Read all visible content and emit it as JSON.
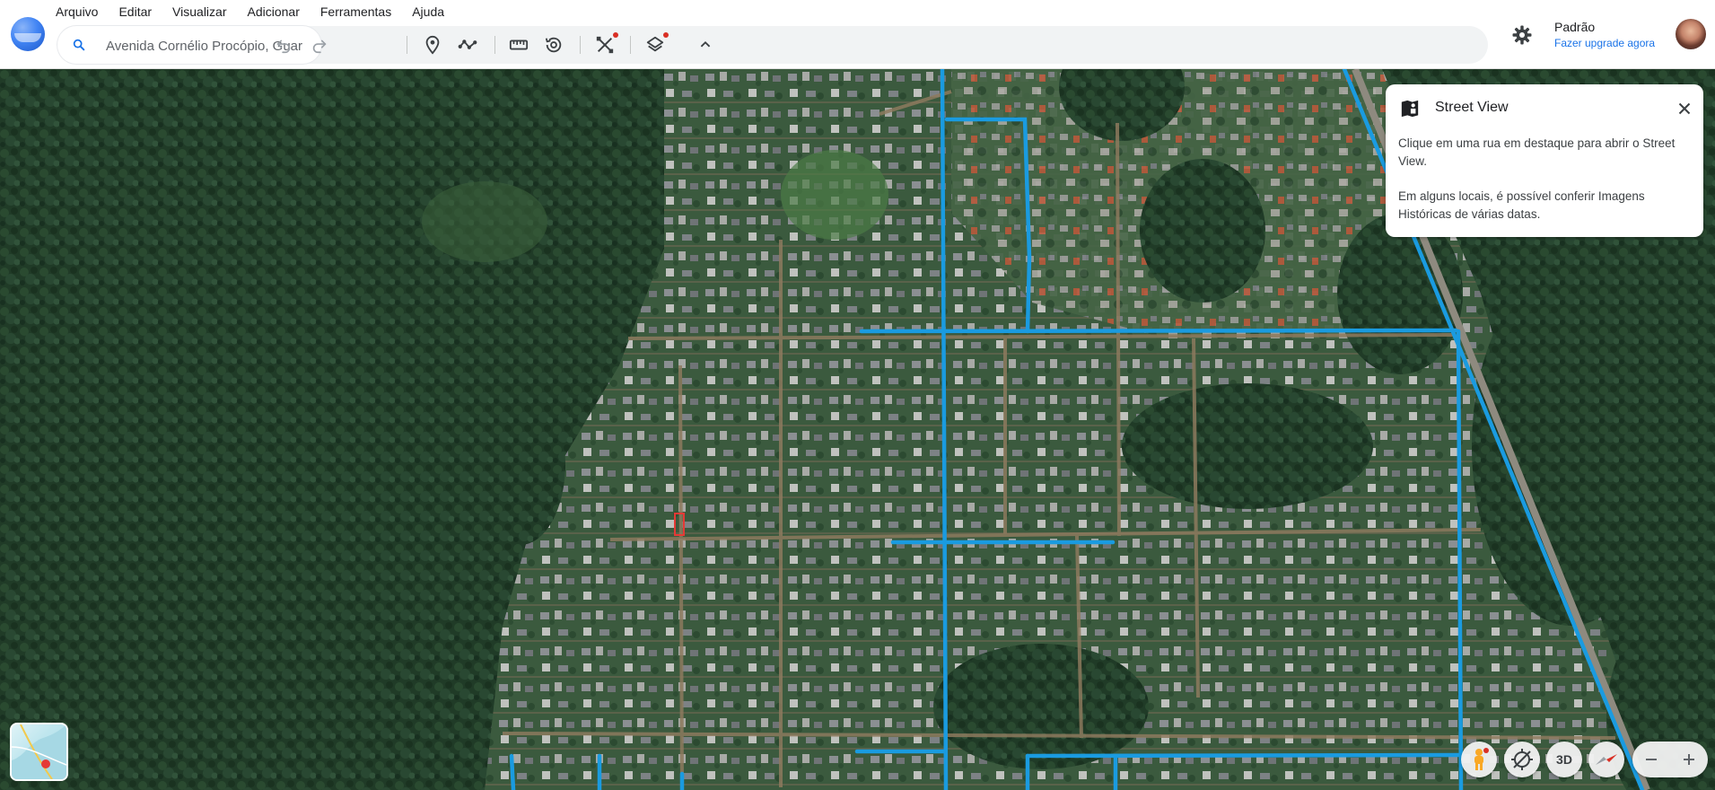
{
  "menu": [
    "Arquivo",
    "Editar",
    "Visualizar",
    "Adicionar",
    "Ferramentas",
    "Ajuda"
  ],
  "search": {
    "value": "Avenida Cornélio Procópio, Guar",
    "icon": "search-icon"
  },
  "toolbar_icons": [
    "undo-icon",
    "redo-icon",
    "placemark-icon",
    "path-icon",
    "ruler-icon",
    "historical-imagery-icon",
    "tools-icon",
    "layers-icon",
    "chevron-up-icon"
  ],
  "account": {
    "name": "Padrão",
    "upgrade": "Fazer upgrade agora"
  },
  "street_view": {
    "title": "Street View",
    "body1": "Clique em uma rua em destaque para abrir o Street View.",
    "body2": "Em alguns locais, é possível conferir Imagens Históricas de várias datas."
  },
  "controls": {
    "view_mode": "3D"
  },
  "colors": {
    "accent": "#1a73e8",
    "street_view_line": "#1a9be0",
    "notification": "#d93025"
  }
}
